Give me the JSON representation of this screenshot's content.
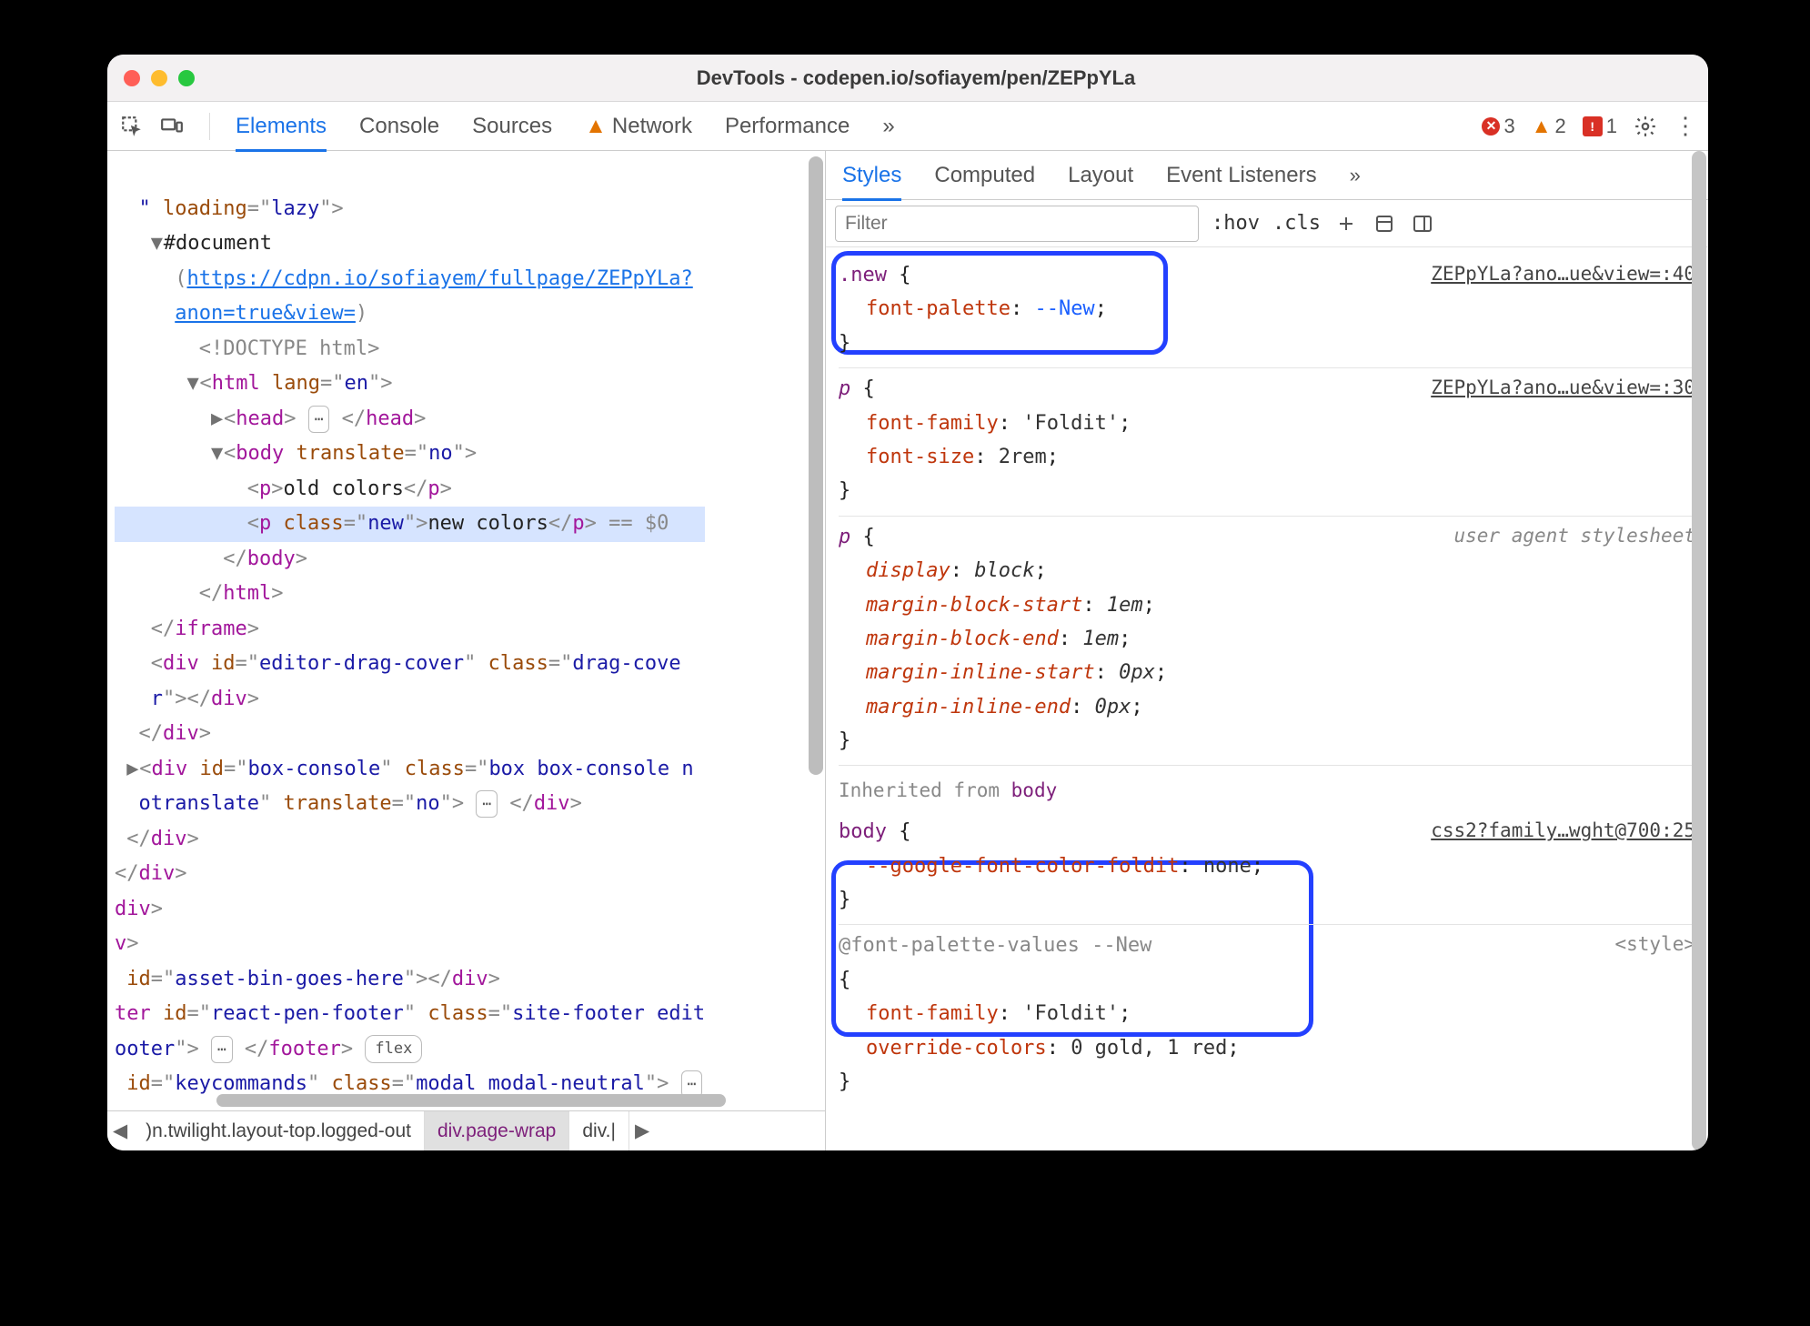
{
  "window": {
    "title": "DevTools - codepen.io/sofiayem/pen/ZEPpYLa"
  },
  "toolbar": {
    "tabs": {
      "elements": "Elements",
      "console": "Console",
      "sources": "Sources",
      "network": "Network",
      "performance": "Performance",
      "more": "»"
    },
    "counts": {
      "errors": "3",
      "warnings": "2",
      "issues": "1"
    }
  },
  "dom": {
    "l0": "\" loading=\"lazy\">",
    "doc": "#document",
    "url1": "https://cdpn.io/sofiayem/fullpage/ZEPpYLa?",
    "url2": "anon=true&view=",
    "doctype": "<!DOCTYPE html>",
    "html_open": "<html lang=\"en\">",
    "head": "<head>",
    "head_close": "</head>",
    "body_open": "<body translate=\"no\">",
    "p_old": "<p>old colors</p>",
    "p_new_open": "<p class=\"new\">",
    "p_new_text": "new colors",
    "p_new_close": "</p>",
    "eqdollar": " == $0",
    "body_close": "</body>",
    "html_close": "</html>",
    "iframe_close": "</iframe>",
    "div_drag": "<div id=\"editor-drag-cover\" class=\"drag-cove",
    "div_drag2": "r\"></div>",
    "div_close": "</div>",
    "box_console1": "<div id=\"box-console\" class=\"box box-console n",
    "box_console2": "otranslate\" translate=\"no\">",
    "box_div_close": "</div>",
    "slash_div1": "</div>",
    "slash_div2": "</div>",
    "trail_div": "div>",
    "trail_v": "v>",
    "asset_bin": " id=\"asset-bin-goes-here\"></div>",
    "footer1": "ter id=\"react-pen-footer\" class=\"site-footer edit",
    "footer2": "ooter\">",
    "footer_flex": "flex",
    "footer_close": "</footer>",
    "keycmd": " id=\"keycommands\" class=\"modal modal-neutral\">"
  },
  "crumbs": {
    "c1": ")n.twilight.layout-top.logged-out",
    "c2": "div.page-wrap",
    "c3": "div.|"
  },
  "styles": {
    "subtabs": {
      "styles": "Styles",
      "computed": "Computed",
      "layout": "Layout",
      "listeners": "Event Listeners",
      "more": "»"
    },
    "filter_placeholder": "Filter",
    "hov": ":hov",
    "cls": ".cls",
    "rule1_src": "ZEPpYLa?ano…ue&view=:40",
    "rule1_sel": ".new",
    "rule1_p1n": "font-palette",
    "rule1_p1v": "--New",
    "rule2_src": "ZEPpYLa?ano…ue&view=:30",
    "rule2_sel": "p",
    "rule2_p1n": "font-family",
    "rule2_p1v": "'Foldit'",
    "rule2_p2n": "font-size",
    "rule2_p2v": "2rem",
    "rule3_src": "user agent stylesheet",
    "rule3_sel": "p",
    "rule3_p1n": "display",
    "rule3_p1v": "block",
    "rule3_p2n": "margin-block-start",
    "rule3_p2v": "1em",
    "rule3_p3n": "margin-block-end",
    "rule3_p3v": "1em",
    "rule3_p4n": "margin-inline-start",
    "rule3_p4v": "0px",
    "rule3_p5n": "margin-inline-end",
    "rule3_p5v": "0px",
    "inherit_label": "Inherited from ",
    "inherit_from": "body",
    "rule4_src": "css2?family…wght@700:25",
    "rule4_sel": "body",
    "rule4_p1n": "--google-font-color-foldit",
    "rule4_p1v": "none",
    "rule5_head": "@font-palette-values --New",
    "rule5_src": "<style>",
    "rule5_p1n": "font-family",
    "rule5_p1v": "'Foldit'",
    "rule5_p2n": "override-colors",
    "rule5_p2v": "0 gold, 1 red"
  }
}
